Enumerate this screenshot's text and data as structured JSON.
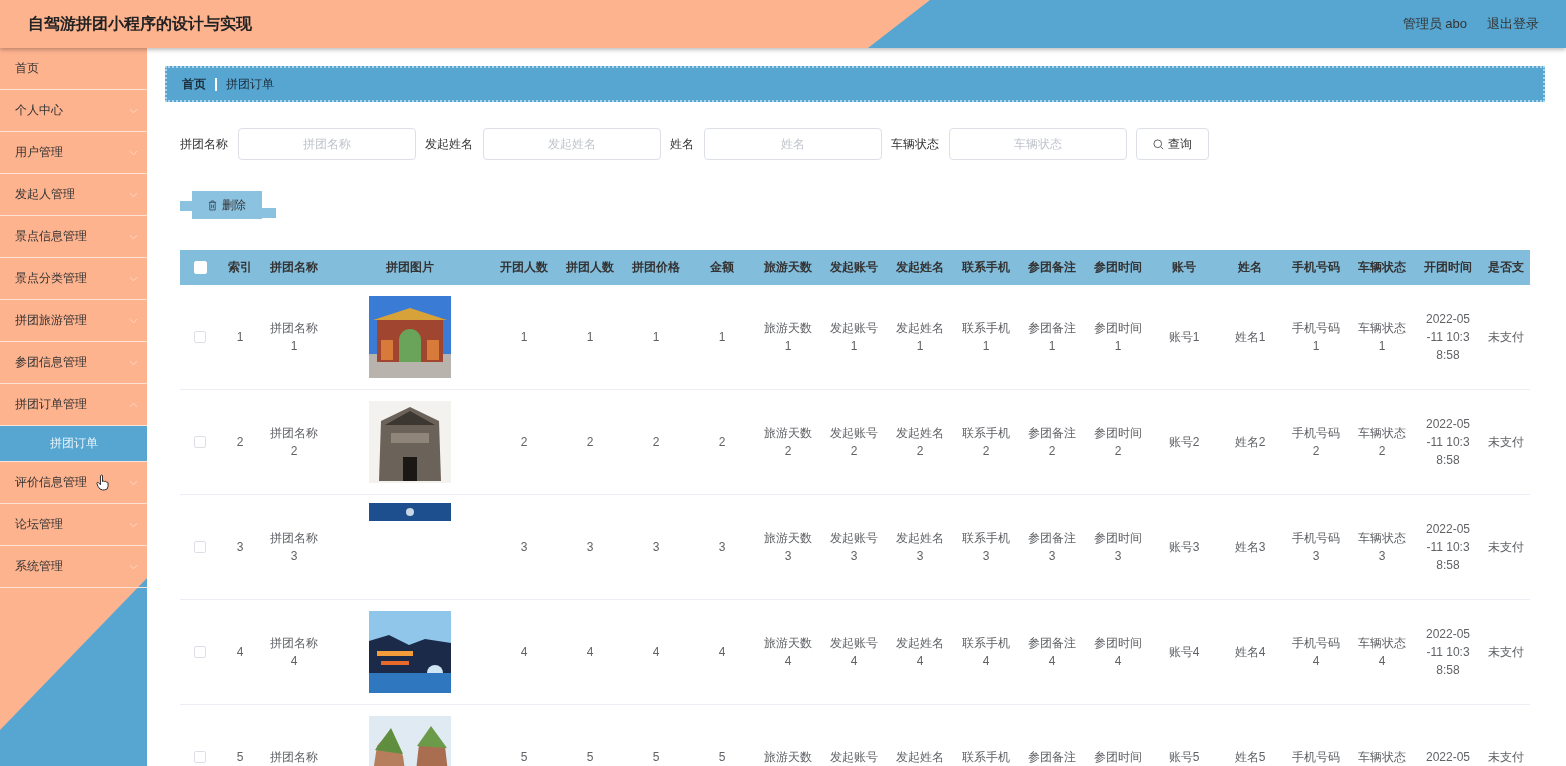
{
  "header": {
    "title": "自驾游拼团小程序的设计与实现",
    "user": "管理员 abo",
    "logout": "退出登录"
  },
  "sidebar": {
    "items": [
      {
        "label": "首页",
        "kind": "link"
      },
      {
        "label": "个人中心",
        "kind": "menu",
        "expanded": false
      },
      {
        "label": "用户管理",
        "kind": "menu",
        "expanded": false
      },
      {
        "label": "发起人管理",
        "kind": "menu",
        "expanded": false
      },
      {
        "label": "景点信息管理",
        "kind": "menu",
        "expanded": false
      },
      {
        "label": "景点分类管理",
        "kind": "menu",
        "expanded": false
      },
      {
        "label": "拼团旅游管理",
        "kind": "menu",
        "expanded": false
      },
      {
        "label": "参团信息管理",
        "kind": "menu",
        "expanded": false
      },
      {
        "label": "拼团订单管理",
        "kind": "menu",
        "expanded": true,
        "children": [
          {
            "label": "拼团订单",
            "selected": true
          }
        ]
      },
      {
        "label": "评价信息管理",
        "kind": "menu",
        "expanded": false,
        "hovered": true
      },
      {
        "label": "论坛管理",
        "kind": "menu",
        "expanded": false
      },
      {
        "label": "系统管理",
        "kind": "menu",
        "expanded": false
      }
    ]
  },
  "breadcrumb": [
    "首页",
    "拼团订单"
  ],
  "search": {
    "fields": [
      {
        "label": "拼团名称",
        "placeholder": "拼团名称"
      },
      {
        "label": "发起姓名",
        "placeholder": "发起姓名"
      },
      {
        "label": "姓名",
        "placeholder": "姓名"
      },
      {
        "label": "车辆状态",
        "placeholder": "车辆状态"
      }
    ],
    "button": "查询"
  },
  "delete_button": "删除",
  "table": {
    "select_all": {
      "checked": false
    },
    "columns": [
      {
        "label": "索引",
        "kind": "text"
      },
      {
        "label": "拼团名称",
        "kind": "text"
      },
      {
        "label": "拼团图片",
        "kind": "picture"
      },
      {
        "label": "开团人数",
        "kind": "text"
      },
      {
        "label": "拼团人数",
        "kind": "text"
      },
      {
        "label": "拼团价格",
        "kind": "text"
      },
      {
        "label": "金额",
        "kind": "text"
      },
      {
        "label": "旅游天数",
        "kind": "text"
      },
      {
        "label": "发起账号",
        "kind": "text"
      },
      {
        "label": "发起姓名",
        "kind": "text"
      },
      {
        "label": "联系手机",
        "kind": "text"
      },
      {
        "label": "参团备注",
        "kind": "text"
      },
      {
        "label": "参团时间",
        "kind": "text"
      },
      {
        "label": "账号",
        "kind": "text"
      },
      {
        "label": "姓名",
        "kind": "text"
      },
      {
        "label": "手机号码",
        "kind": "text"
      },
      {
        "label": "车辆状态",
        "kind": "text"
      },
      {
        "label": "开团时间",
        "kind": "time"
      },
      {
        "label": "是否支",
        "kind": "text"
      }
    ],
    "rows": [
      {
        "checked": false,
        "cells": [
          "1",
          "拼团名称1",
          {
            "kind": "picture",
            "loading": false
          },
          "1",
          "1",
          "1",
          "1",
          "旅游天数1",
          "发起账号1",
          "发起姓名1",
          "联系手机1",
          "参团备注1",
          "参团时间1",
          "账号1",
          "姓名1",
          "手机号码1",
          "车辆状态1",
          "2022-05-11 10:38:58",
          "未支付"
        ]
      },
      {
        "checked": false,
        "cells": [
          "2",
          "拼团名称2",
          {
            "kind": "picture",
            "loading": false
          },
          "2",
          "2",
          "2",
          "2",
          "旅游天数2",
          "发起账号2",
          "发起姓名2",
          "联系手机2",
          "参团备注2",
          "参团时间2",
          "账号2",
          "姓名2",
          "手机号码2",
          "车辆状态2",
          "2022-05-11 10:38:58",
          "未支付"
        ]
      },
      {
        "checked": false,
        "cells": [
          "3",
          "拼团名称3",
          {
            "kind": "picture",
            "loading": true
          },
          "3",
          "3",
          "3",
          "3",
          "旅游天数3",
          "发起账号3",
          "发起姓名3",
          "联系手机3",
          "参团备注3",
          "参团时间3",
          "账号3",
          "姓名3",
          "手机号码3",
          "车辆状态3",
          "2022-05-11 10:38:58",
          "未支付"
        ]
      },
      {
        "checked": false,
        "cells": [
          "4",
          "拼团名称4",
          {
            "kind": "picture",
            "loading": false
          },
          "4",
          "4",
          "4",
          "4",
          "旅游天数4",
          "发起账号4",
          "发起姓名4",
          "联系手机4",
          "参团备注4",
          "参团时间4",
          "账号4",
          "姓名4",
          "手机号码4",
          "车辆状态4",
          "2022-05-11 10:38:58",
          "未支付"
        ]
      },
      {
        "checked": false,
        "cells": [
          "5",
          "拼团名称",
          {
            "kind": "picture",
            "loading": false
          },
          "5",
          "5",
          "5",
          "5",
          "旅游天数",
          "发起账号",
          "发起姓名",
          "联系手机",
          "参团备注",
          "参团时间",
          "账号5",
          "姓名5",
          "手机号码",
          "车辆状态",
          "2022-05",
          "未支付"
        ]
      }
    ]
  }
}
